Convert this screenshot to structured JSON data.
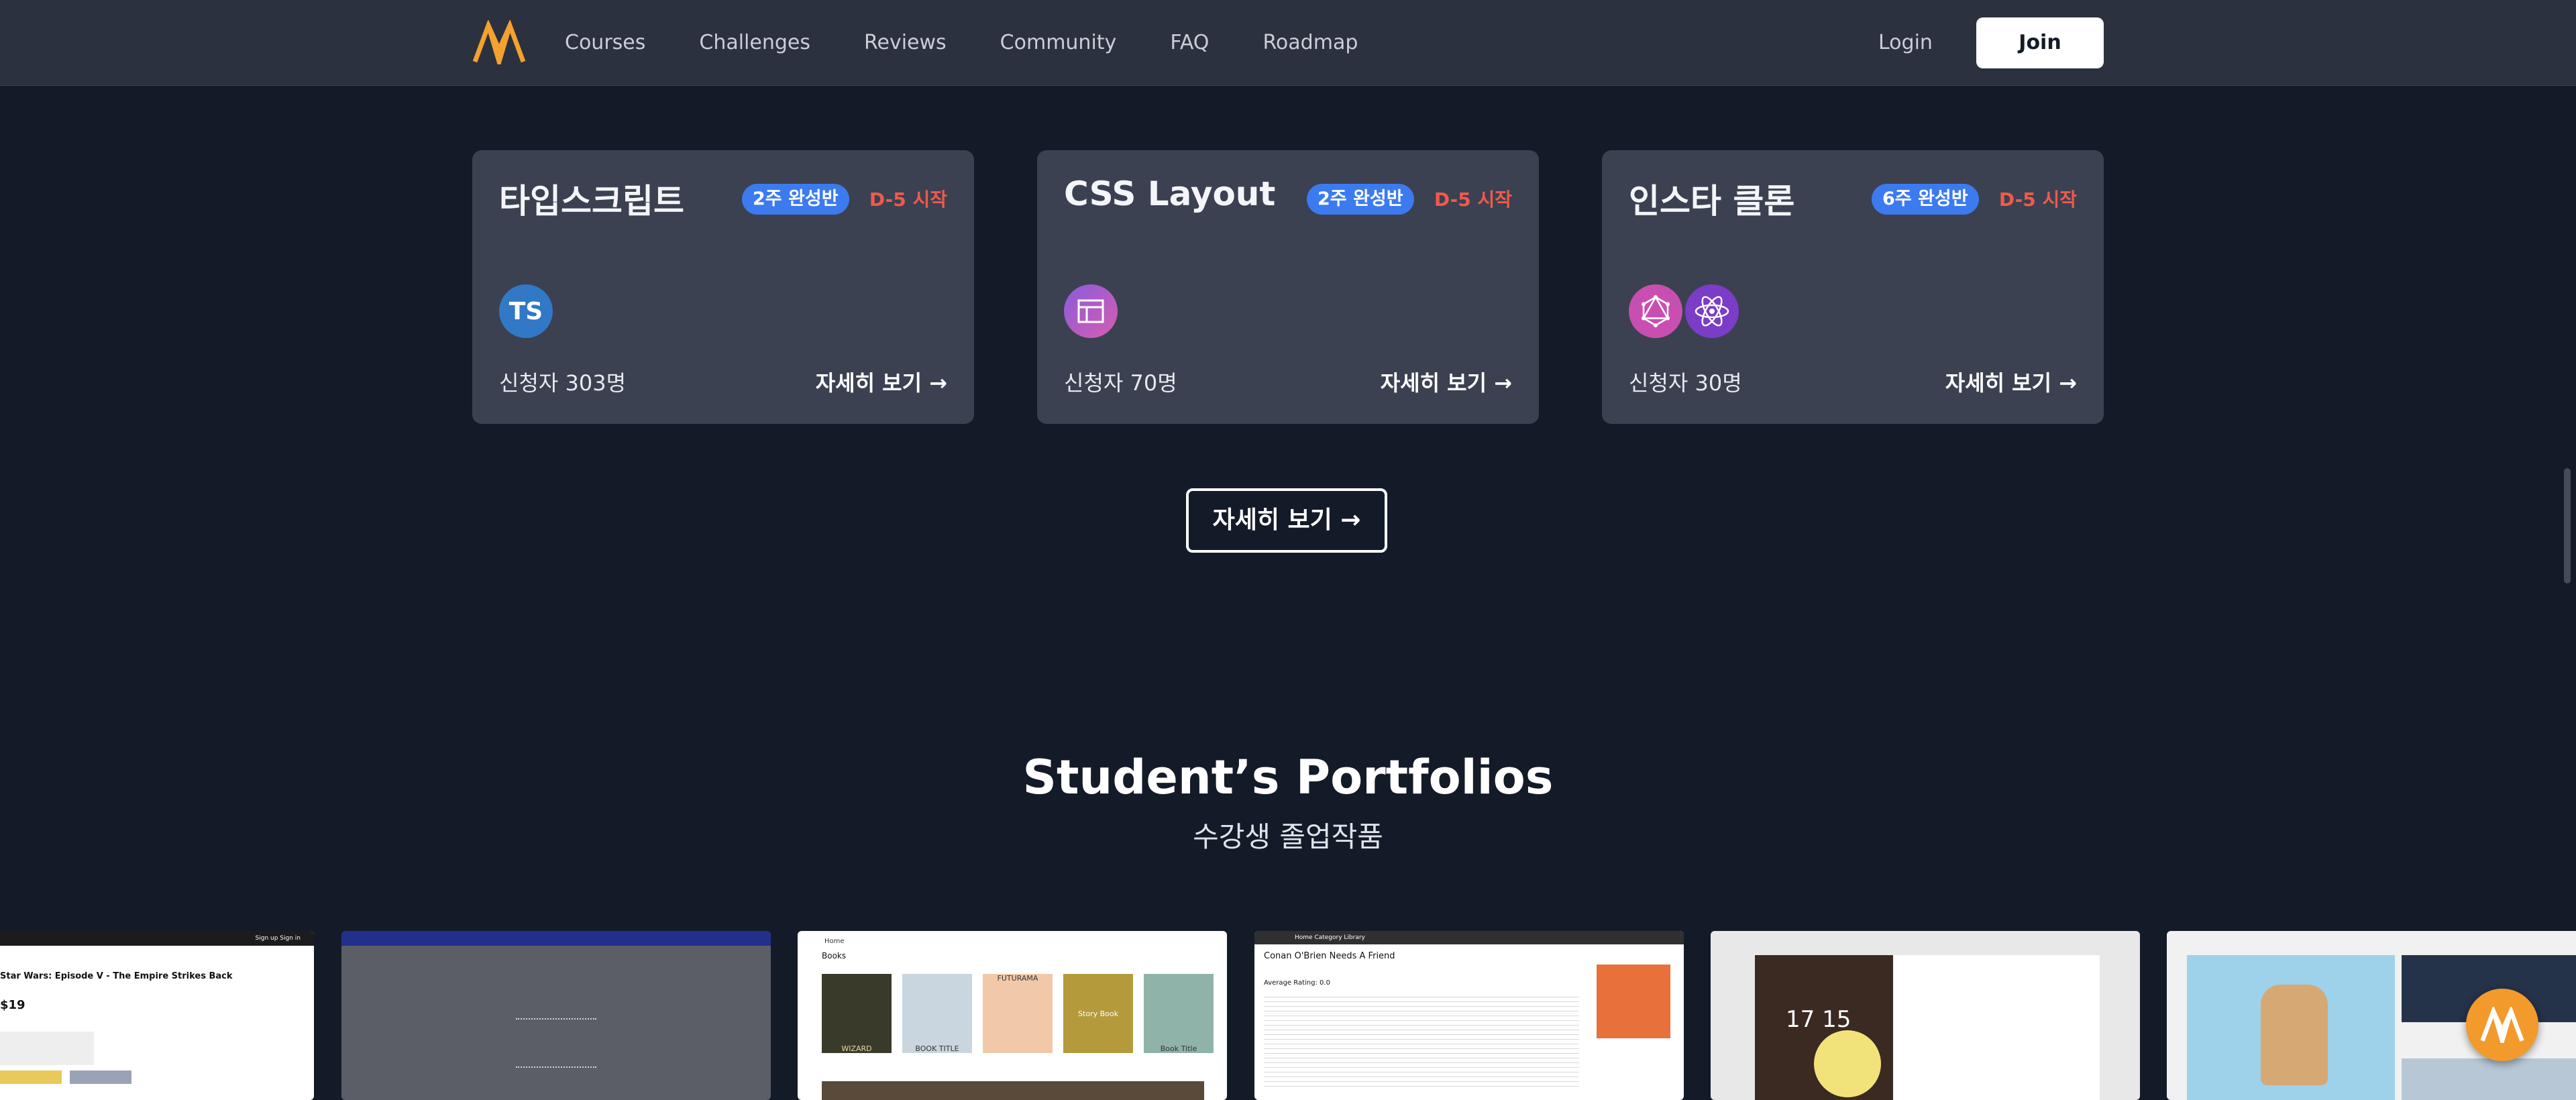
{
  "header": {
    "nav": [
      "Courses",
      "Challenges",
      "Reviews",
      "Community",
      "FAQ",
      "Roadmap"
    ],
    "login": "Login",
    "join": "Join"
  },
  "cards": [
    {
      "title": "타입스크립트",
      "badge": "2주 완성반",
      "dday": "D-5 시작",
      "icon_text": "TS",
      "icons": [
        "typescript-icon"
      ],
      "count": "신청자 303명",
      "link": "자세히 보기 →"
    },
    {
      "title": "CSS Layout",
      "badge": "2주 완성반",
      "dday": "D-5 시작",
      "icons": [
        "layout-icon"
      ],
      "count": "신청자 70명",
      "link": "자세히 보기 →"
    },
    {
      "title": "인스타 클론",
      "badge": "6주 완성반",
      "dday": "D-5 시작",
      "icons": [
        "graphql-icon",
        "react-icon"
      ],
      "count": "신청자 30명",
      "link": "자세히 보기 →"
    }
  ],
  "more_button": "자세히 보기 →",
  "portfolios": {
    "title": "Student’s Portfolios",
    "subtitle": "수강생 졸업작품",
    "items": [
      {
        "header_text": "Sign up Sign in",
        "title": "Star Wars: Episode V - The Empire Strikes Back",
        "price": "$19"
      },
      {
        "header_text": "",
        "title": "",
        "price": ""
      },
      {
        "header_text": "Home",
        "title": "Books",
        "covers": [
          "WIZARD",
          "BOOK TITLE",
          "FUTURAMA",
          "Story Book",
          "Book Title"
        ]
      },
      {
        "header_text": "Home Category Library",
        "title": "Conan O'Brien Needs A Friend",
        "rating": "Average Rating: 0.0"
      },
      {
        "header_text": "",
        "clock": "17 15"
      },
      {
        "header_text": "",
        "title": ""
      }
    ]
  },
  "colors": {
    "background": "#141b28",
    "header": "#2b313e",
    "card": "#3b4150",
    "badge": "#3c7af0",
    "dday": "#ef5a4c",
    "accent": "#f39a2c"
  }
}
